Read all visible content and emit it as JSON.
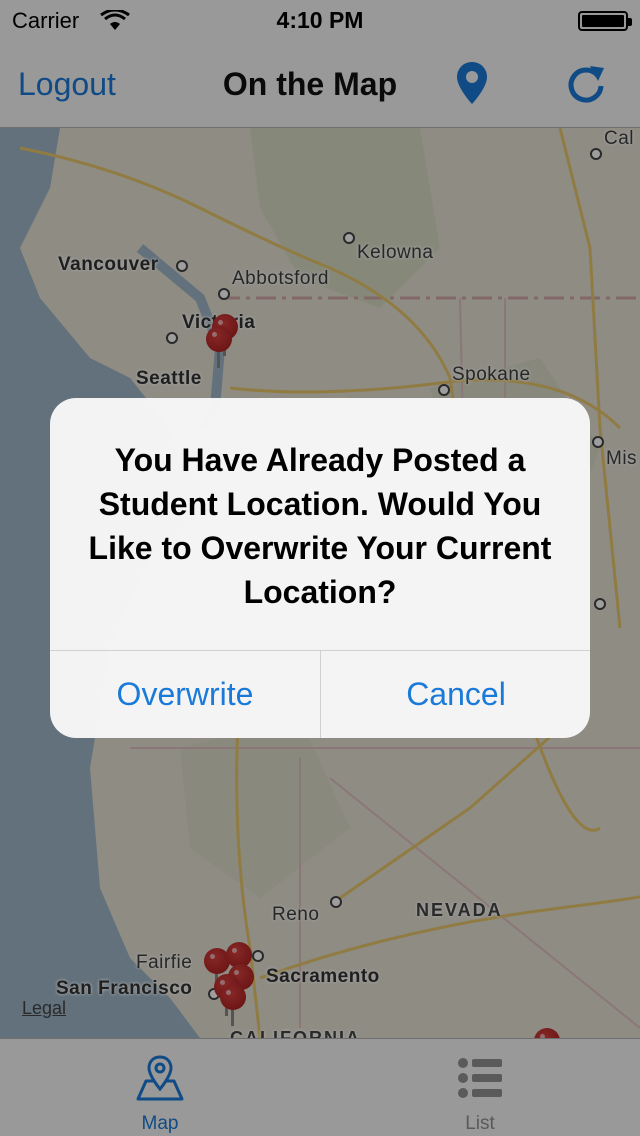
{
  "status_bar": {
    "carrier": "Carrier",
    "time": "4:10 PM"
  },
  "nav": {
    "left_button": "Logout",
    "title": "On the Map",
    "pin_icon": "location-pin-icon",
    "refresh_icon": "refresh-icon"
  },
  "map": {
    "labels": {
      "vancouver": "Vancouver",
      "abbotsford": "Abbotsford",
      "kelowna": "Kelowna",
      "victoria": "Victoria",
      "seattle": "Seattle",
      "spokane": "Spokane",
      "cal": "Cal",
      "mis": "Mis",
      "reno": "Reno",
      "nevada": "NEVADA",
      "fairfield": "Fairfie",
      "sacramento": "Sacramento",
      "san_francisco": "San Francisco",
      "california": "CALIFORNIA"
    },
    "legal": "Legal"
  },
  "alert": {
    "title": "You Have Already Posted a Student Location. Would You Like to Overwrite Your Current Location?",
    "confirm": "Overwrite",
    "cancel": "Cancel"
  },
  "tab_bar": {
    "tabs": [
      {
        "label": "Map",
        "icon": "map-icon",
        "selected": true
      },
      {
        "label": "List",
        "icon": "list-icon",
        "selected": false
      }
    ]
  },
  "colors": {
    "accent": "#1a7ad9",
    "pin": "#b22222"
  }
}
